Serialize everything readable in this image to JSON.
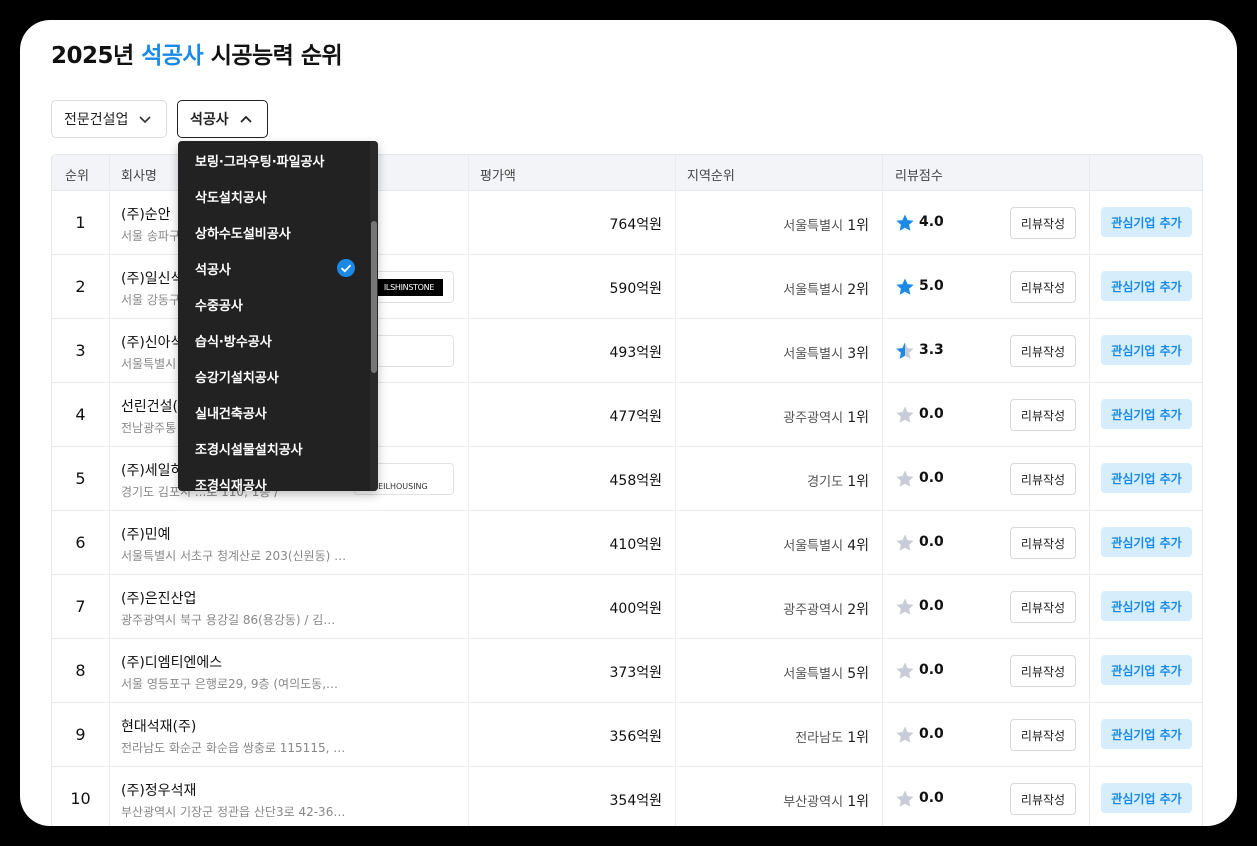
{
  "title": {
    "year": "2025년",
    "category": "석공사",
    "suffix": "시공능력 순위"
  },
  "filters": {
    "industry": {
      "label": "전문건설업"
    },
    "trade": {
      "label": "석공사"
    }
  },
  "table": {
    "headers": {
      "rank": "순위",
      "company": "회사명",
      "amount": "평가액",
      "region_rank": "지역순위",
      "review_score": "리뷰점수"
    },
    "review_button_label": "리뷰작성",
    "favorite_button_label": "관심기업 추가",
    "rows": [
      {
        "rank": "1",
        "name": "(주)순안",
        "address": "서울 송파구",
        "amount": "764억원",
        "region": "서울특별시",
        "region_rank": "1위",
        "score": "4.0",
        "star": "full"
      },
      {
        "rank": "2",
        "name": "(주)일신석",
        "address": "서울 강동구",
        "amount": "590억원",
        "region": "서울특별시",
        "region_rank": "2위",
        "score": "5.0",
        "star": "full",
        "logo": "ILSHINSTONE"
      },
      {
        "rank": "3",
        "name": "(주)신아석",
        "address": "서울특별시",
        "amount": "493억원",
        "region": "서울특별시",
        "region_rank": "3위",
        "score": "3.3",
        "star": "half",
        "logo": ""
      },
      {
        "rank": "4",
        "name": "선린건설(",
        "address": "전남광주통",
        "amount": "477억원",
        "region": "광주광역시",
        "region_rank": "1위",
        "score": "0.0",
        "star": "empty"
      },
      {
        "rank": "5",
        "name": "(주)세일하",
        "address": "경기도 김포시 ...로 110, 1층 /",
        "amount": "458억원",
        "region": "경기도",
        "region_rank": "1위",
        "score": "0.0",
        "star": "empty",
        "logo": "SEILHOUSING"
      },
      {
        "rank": "6",
        "name": "(주)민예",
        "address": "서울특별시 서초구 청계산로 203(신원동) …",
        "amount": "410억원",
        "region": "서울특별시",
        "region_rank": "4위",
        "score": "0.0",
        "star": "empty"
      },
      {
        "rank": "7",
        "name": "(주)은진산업",
        "address": "광주광역시 북구 용강길 86(용강동) / 김…",
        "amount": "400억원",
        "region": "광주광역시",
        "region_rank": "2위",
        "score": "0.0",
        "star": "empty"
      },
      {
        "rank": "8",
        "name": "(주)디엠티엔에스",
        "address": "서울 영등포구 은행로29, 9층 (여의도동,…",
        "amount": "373억원",
        "region": "서울특별시",
        "region_rank": "5위",
        "score": "0.0",
        "star": "empty"
      },
      {
        "rank": "9",
        "name": "현대석재(주)",
        "address": "전라남도 화순군 화순읍 쌍충로 115115, …",
        "amount": "356억원",
        "region": "전라남도",
        "region_rank": "1위",
        "score": "0.0",
        "star": "empty"
      },
      {
        "rank": "10",
        "name": "(주)정우석재",
        "address": "부산광역시 기장군 정관읍 산단3로 42-36…",
        "amount": "354억원",
        "region": "부산광역시",
        "region_rank": "1위",
        "score": "0.0",
        "star": "empty"
      }
    ]
  },
  "dropdown": {
    "items": [
      {
        "label": "보링·그라우팅·파일공사",
        "selected": false
      },
      {
        "label": "삭도설치공사",
        "selected": false
      },
      {
        "label": "상하수도설비공사",
        "selected": false
      },
      {
        "label": "석공사",
        "selected": true
      },
      {
        "label": "수중공사",
        "selected": false
      },
      {
        "label": "습식·방수공사",
        "selected": false
      },
      {
        "label": "승강기설치공사",
        "selected": false
      },
      {
        "label": "실내건축공사",
        "selected": false
      },
      {
        "label": "조경시설물설치공사",
        "selected": false
      },
      {
        "label": "조경식재공사",
        "selected": false
      }
    ]
  },
  "colors": {
    "accent": "#1a8ae6",
    "star_active": "#1a8ae6",
    "star_inactive": "#c8ccd6",
    "favorite_bg": "#d6eefb"
  }
}
